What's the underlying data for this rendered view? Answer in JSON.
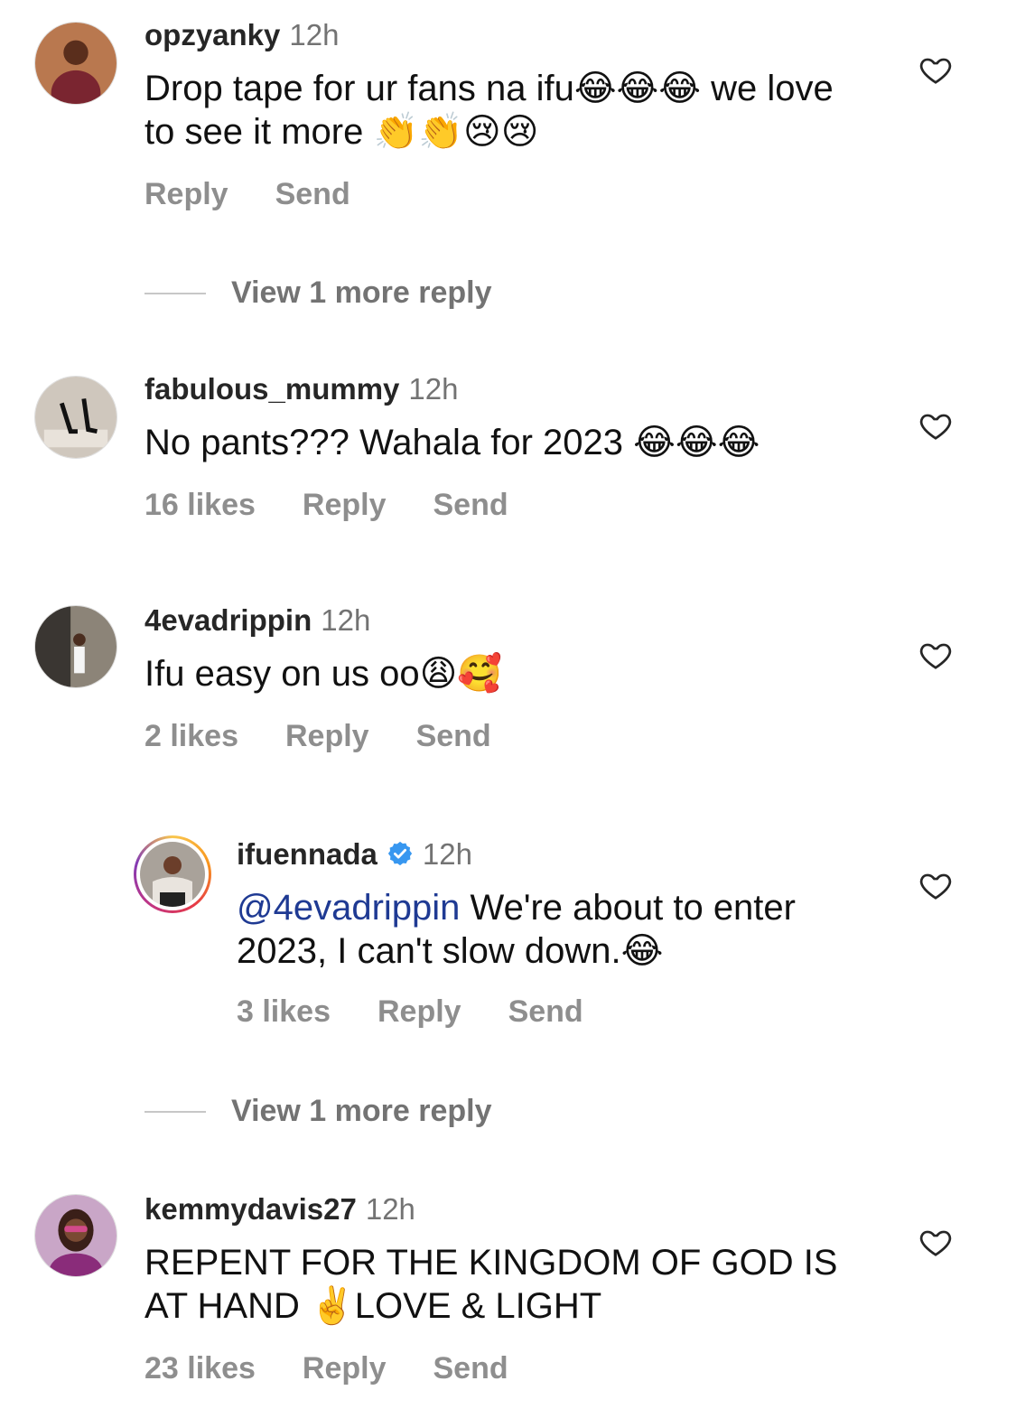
{
  "comments": [
    {
      "username": "opzyanky",
      "time": "12h",
      "text": "Drop tape for ur fans na ifu😂😂😂 we love to see it more 👏👏😢😢",
      "likes": "",
      "reply": "Reply",
      "send": "Send"
    },
    {
      "username": "fabulous_mummy",
      "time": "12h",
      "text": "No pants??? Wahala for 2023 😂😂😂",
      "likes": "16 likes",
      "reply": "Reply",
      "send": "Send"
    },
    {
      "username": "4evadrippin",
      "time": "12h",
      "text": "Ifu easy on us oo😩🥰",
      "likes": "2 likes",
      "reply": "Reply",
      "send": "Send"
    },
    {
      "username": "ifuennada",
      "time": "12h",
      "mention": "@4evadrippin",
      "text": " We're about to enter 2023, I can't slow down.😂",
      "likes": "3 likes",
      "reply": "Reply",
      "send": "Send"
    },
    {
      "username": "kemmydavis27",
      "time": "12h",
      "text": "REPENT FOR THE KINGDOM OF GOD IS AT HAND ✌️LOVE & LIGHT",
      "likes": "23 likes",
      "reply": "Reply",
      "send": "Send"
    }
  ],
  "view_more_1": "View 1 more reply",
  "view_more_2": "View 1 more reply",
  "icons": {
    "like": "heart-outline-icon",
    "verified": "verified-badge-icon"
  },
  "colors": {
    "muted": "#8e8e8e",
    "mention": "#1f3a93",
    "verified": "#3797f0"
  }
}
